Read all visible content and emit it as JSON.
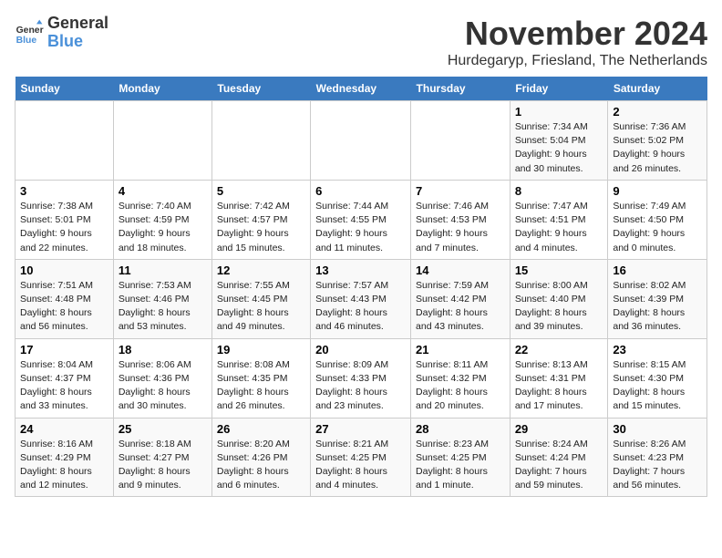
{
  "header": {
    "logo_line1": "General",
    "logo_line2": "Blue",
    "month_title": "November 2024",
    "location": "Hurdegaryp, Friesland, The Netherlands"
  },
  "weekdays": [
    "Sunday",
    "Monday",
    "Tuesday",
    "Wednesday",
    "Thursday",
    "Friday",
    "Saturday"
  ],
  "weeks": [
    [
      {
        "day": "",
        "info": ""
      },
      {
        "day": "",
        "info": ""
      },
      {
        "day": "",
        "info": ""
      },
      {
        "day": "",
        "info": ""
      },
      {
        "day": "",
        "info": ""
      },
      {
        "day": "1",
        "info": "Sunrise: 7:34 AM\nSunset: 5:04 PM\nDaylight: 9 hours and 30 minutes."
      },
      {
        "day": "2",
        "info": "Sunrise: 7:36 AM\nSunset: 5:02 PM\nDaylight: 9 hours and 26 minutes."
      }
    ],
    [
      {
        "day": "3",
        "info": "Sunrise: 7:38 AM\nSunset: 5:01 PM\nDaylight: 9 hours and 22 minutes."
      },
      {
        "day": "4",
        "info": "Sunrise: 7:40 AM\nSunset: 4:59 PM\nDaylight: 9 hours and 18 minutes."
      },
      {
        "day": "5",
        "info": "Sunrise: 7:42 AM\nSunset: 4:57 PM\nDaylight: 9 hours and 15 minutes."
      },
      {
        "day": "6",
        "info": "Sunrise: 7:44 AM\nSunset: 4:55 PM\nDaylight: 9 hours and 11 minutes."
      },
      {
        "day": "7",
        "info": "Sunrise: 7:46 AM\nSunset: 4:53 PM\nDaylight: 9 hours and 7 minutes."
      },
      {
        "day": "8",
        "info": "Sunrise: 7:47 AM\nSunset: 4:51 PM\nDaylight: 9 hours and 4 minutes."
      },
      {
        "day": "9",
        "info": "Sunrise: 7:49 AM\nSunset: 4:50 PM\nDaylight: 9 hours and 0 minutes."
      }
    ],
    [
      {
        "day": "10",
        "info": "Sunrise: 7:51 AM\nSunset: 4:48 PM\nDaylight: 8 hours and 56 minutes."
      },
      {
        "day": "11",
        "info": "Sunrise: 7:53 AM\nSunset: 4:46 PM\nDaylight: 8 hours and 53 minutes."
      },
      {
        "day": "12",
        "info": "Sunrise: 7:55 AM\nSunset: 4:45 PM\nDaylight: 8 hours and 49 minutes."
      },
      {
        "day": "13",
        "info": "Sunrise: 7:57 AM\nSunset: 4:43 PM\nDaylight: 8 hours and 46 minutes."
      },
      {
        "day": "14",
        "info": "Sunrise: 7:59 AM\nSunset: 4:42 PM\nDaylight: 8 hours and 43 minutes."
      },
      {
        "day": "15",
        "info": "Sunrise: 8:00 AM\nSunset: 4:40 PM\nDaylight: 8 hours and 39 minutes."
      },
      {
        "day": "16",
        "info": "Sunrise: 8:02 AM\nSunset: 4:39 PM\nDaylight: 8 hours and 36 minutes."
      }
    ],
    [
      {
        "day": "17",
        "info": "Sunrise: 8:04 AM\nSunset: 4:37 PM\nDaylight: 8 hours and 33 minutes."
      },
      {
        "day": "18",
        "info": "Sunrise: 8:06 AM\nSunset: 4:36 PM\nDaylight: 8 hours and 30 minutes."
      },
      {
        "day": "19",
        "info": "Sunrise: 8:08 AM\nSunset: 4:35 PM\nDaylight: 8 hours and 26 minutes."
      },
      {
        "day": "20",
        "info": "Sunrise: 8:09 AM\nSunset: 4:33 PM\nDaylight: 8 hours and 23 minutes."
      },
      {
        "day": "21",
        "info": "Sunrise: 8:11 AM\nSunset: 4:32 PM\nDaylight: 8 hours and 20 minutes."
      },
      {
        "day": "22",
        "info": "Sunrise: 8:13 AM\nSunset: 4:31 PM\nDaylight: 8 hours and 17 minutes."
      },
      {
        "day": "23",
        "info": "Sunrise: 8:15 AM\nSunset: 4:30 PM\nDaylight: 8 hours and 15 minutes."
      }
    ],
    [
      {
        "day": "24",
        "info": "Sunrise: 8:16 AM\nSunset: 4:29 PM\nDaylight: 8 hours and 12 minutes."
      },
      {
        "day": "25",
        "info": "Sunrise: 8:18 AM\nSunset: 4:27 PM\nDaylight: 8 hours and 9 minutes."
      },
      {
        "day": "26",
        "info": "Sunrise: 8:20 AM\nSunset: 4:26 PM\nDaylight: 8 hours and 6 minutes."
      },
      {
        "day": "27",
        "info": "Sunrise: 8:21 AM\nSunset: 4:25 PM\nDaylight: 8 hours and 4 minutes."
      },
      {
        "day": "28",
        "info": "Sunrise: 8:23 AM\nSunset: 4:25 PM\nDaylight: 8 hours and 1 minute."
      },
      {
        "day": "29",
        "info": "Sunrise: 8:24 AM\nSunset: 4:24 PM\nDaylight: 7 hours and 59 minutes."
      },
      {
        "day": "30",
        "info": "Sunrise: 8:26 AM\nSunset: 4:23 PM\nDaylight: 7 hours and 56 minutes."
      }
    ]
  ]
}
